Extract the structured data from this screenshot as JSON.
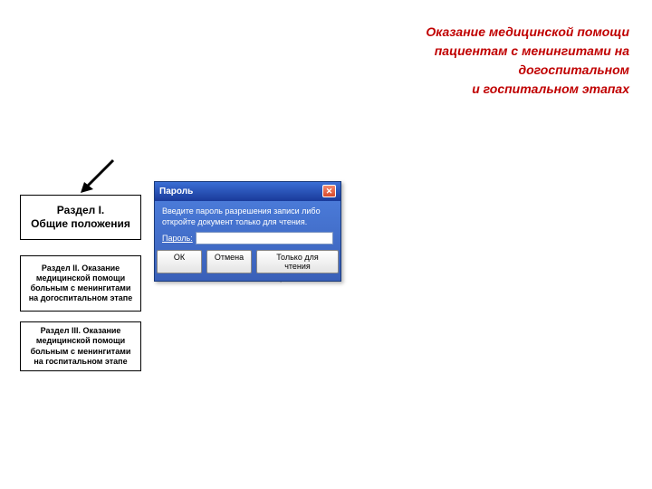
{
  "title": {
    "line1": "Оказание медицинской помощи",
    "line2": "пациентам с менингитами на догоспитальном",
    "line3": "и госпитальном этапах"
  },
  "sections": {
    "s1": "Раздел I.\nОбщие положения",
    "s2": "Раздел II. Оказание медицинской помощи больным с менингитами на догоспитальном этапе",
    "s3": "Раздел III. Оказание медицинской помощи больным с менингитами на госпитальном этапе"
  },
  "dialog": {
    "title": "Пароль",
    "instruction": "Введите пароль разрешения записи либо откройте документ только для чтения.",
    "password_label": "Пароль:",
    "password_value": "",
    "ok": "ОК",
    "cancel": "Отмена",
    "readonly": "Только для чтения"
  }
}
